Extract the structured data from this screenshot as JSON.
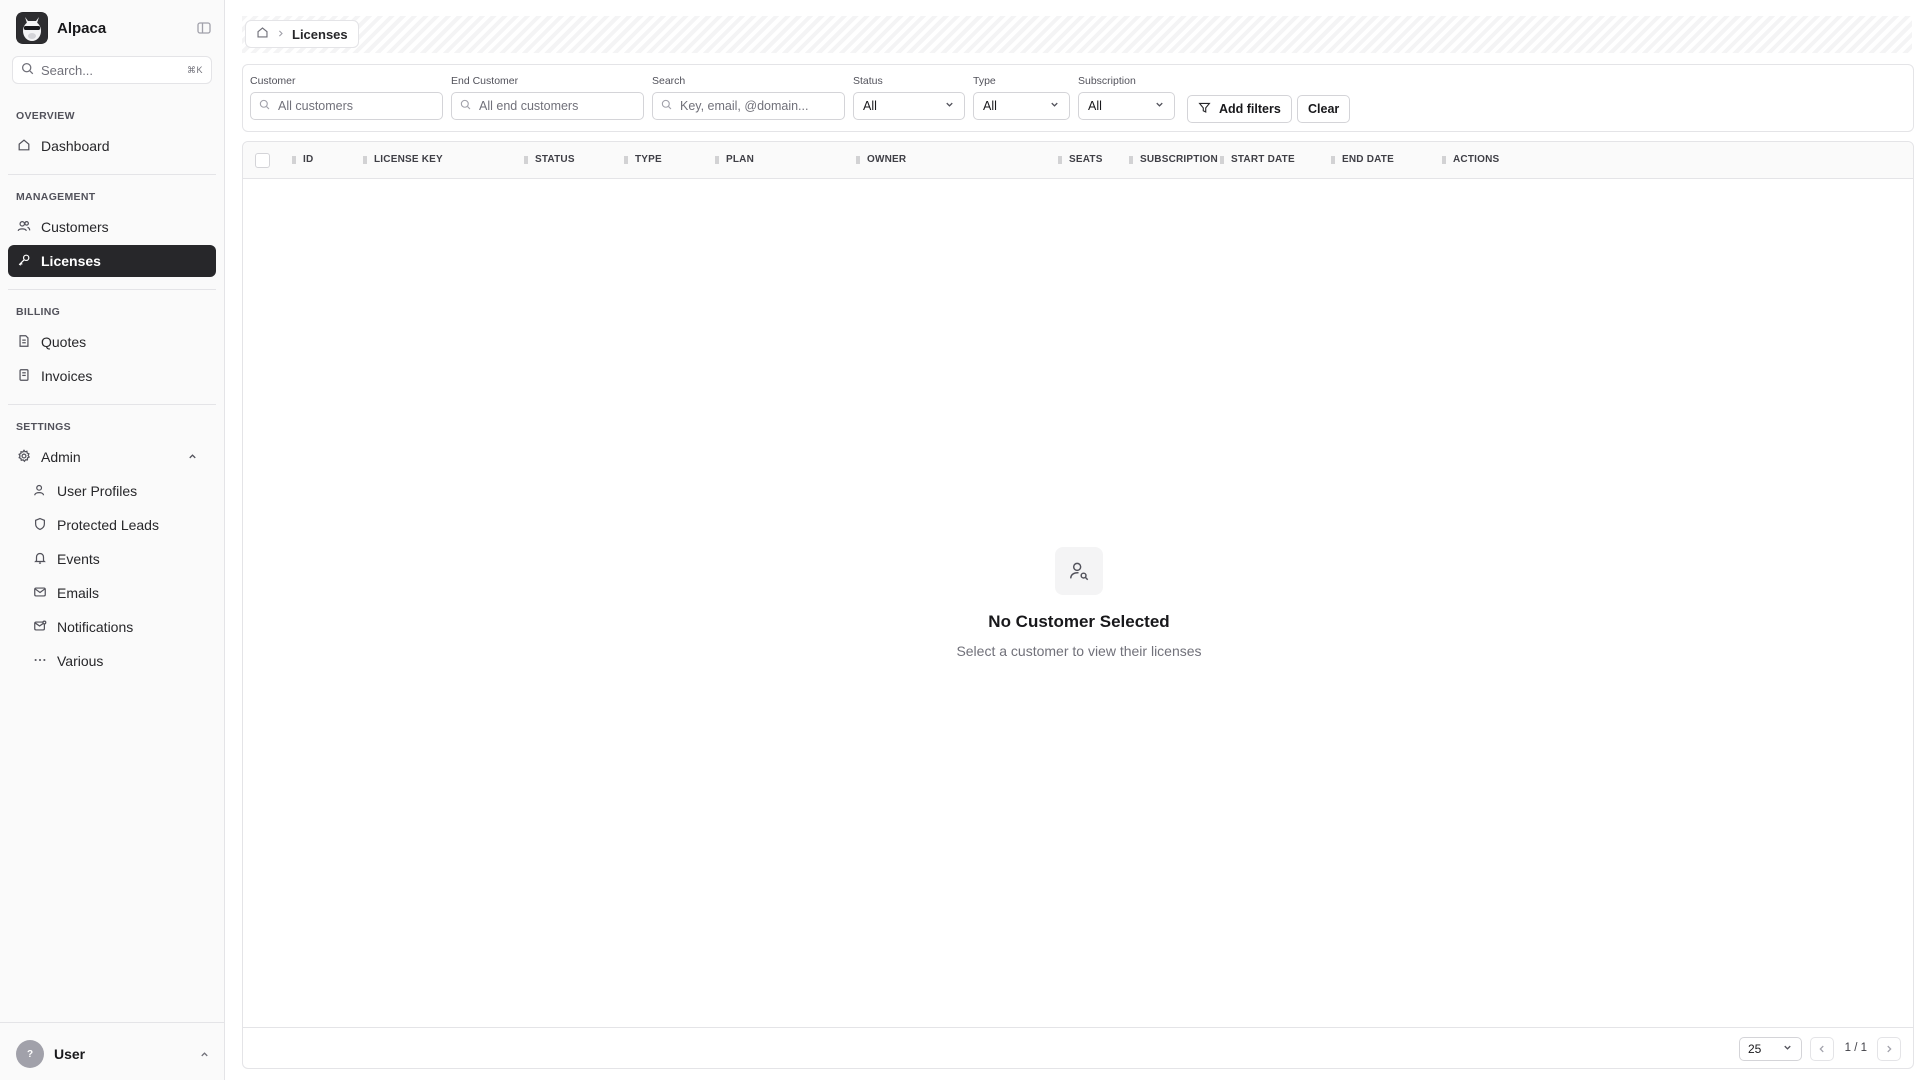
{
  "app": {
    "name": "Alpaca"
  },
  "sidebar": {
    "search_placeholder": "Search...",
    "search_shortcut": "⌘K",
    "sections": {
      "overview": "OVERVIEW",
      "management": "MANAGEMENT",
      "billing": "BILLING",
      "settings": "SETTINGS"
    },
    "items": {
      "dashboard": "Dashboard",
      "customers": "Customers",
      "licenses": "Licenses",
      "quotes": "Quotes",
      "invoices": "Invoices",
      "admin": "Admin",
      "user_profiles": "User Profiles",
      "protected_leads": "Protected Leads",
      "events": "Events",
      "emails": "Emails",
      "notifications": "Notifications",
      "various": "Various"
    },
    "user": {
      "initial": "?",
      "name": "User"
    }
  },
  "breadcrumb": {
    "current": "Licenses"
  },
  "filters": {
    "customer": {
      "label": "Customer",
      "placeholder": "All customers"
    },
    "end_customer": {
      "label": "End Customer",
      "placeholder": "All end customers"
    },
    "search": {
      "label": "Search",
      "placeholder": "Key, email, @domain..."
    },
    "status": {
      "label": "Status",
      "value": "All"
    },
    "type": {
      "label": "Type",
      "value": "All"
    },
    "subscription": {
      "label": "Subscription",
      "value": "All"
    },
    "add_filters": "Add filters",
    "clear": "Clear"
  },
  "table": {
    "columns": [
      "ID",
      "LICENSE KEY",
      "STATUS",
      "TYPE",
      "PLAN",
      "OWNER",
      "SEATS",
      "SUBSCRIPTION",
      "START DATE",
      "END DATE",
      "ACTIONS"
    ],
    "empty": {
      "title": "No Customer Selected",
      "subtitle": "Select a customer to view their licenses"
    },
    "page_size": "25",
    "page_info": "1 / 1"
  },
  "colors": {
    "active_nav_bg": "#27272a",
    "border": "#e4e4e7",
    "muted_text": "#71717a"
  }
}
